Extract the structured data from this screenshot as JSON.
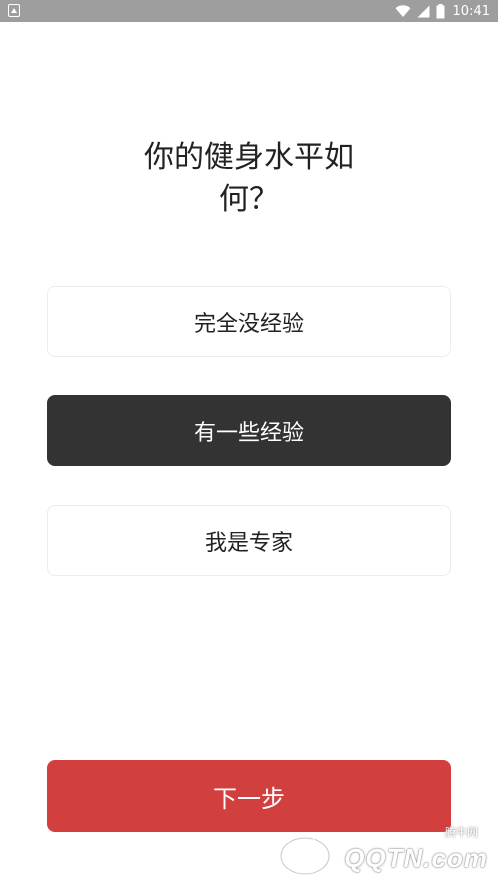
{
  "status_bar": {
    "time": "10:41",
    "icons": [
      "app-notification-icon",
      "wifi-icon",
      "cell-signal-icon",
      "battery-icon"
    ]
  },
  "question": {
    "title": "你的健身水平如何？"
  },
  "options": [
    {
      "label": "完全没经验",
      "selected": false
    },
    {
      "label": "有一些经验",
      "selected": true
    },
    {
      "label": "我是专家",
      "selected": false
    }
  ],
  "next_button": {
    "label": "下一步"
  },
  "watermark": {
    "brand": "QQTN.com",
    "cn": "腾牛网"
  },
  "colors": {
    "selected_bg": "#333333",
    "primary_red": "#d23f3f",
    "status_bar": "#9e9e9e"
  }
}
